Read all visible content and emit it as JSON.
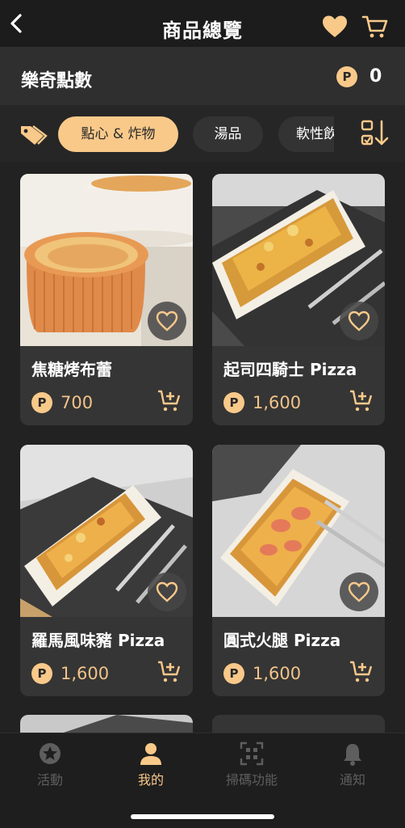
{
  "header": {
    "title": "商品總覽",
    "back_icon": "chevron-left-icon",
    "fav_icon": "heart-icon",
    "cart_icon": "cart-icon"
  },
  "points": {
    "label": "樂奇點數",
    "badge": "P",
    "value": "0"
  },
  "categories": {
    "tag_icon": "tag-icon",
    "chips": [
      {
        "label": "點心 & 炸物",
        "active": true
      },
      {
        "label": "湯品",
        "active": false
      },
      {
        "label": "軟性飲",
        "active": false
      }
    ],
    "sort_icon": "sort-icon"
  },
  "products": [
    {
      "name": "焦糖烤布蕾",
      "price": "700",
      "badge": "P"
    },
    {
      "name": "起司四騎士 Pizza",
      "price": "1,600",
      "badge": "P"
    },
    {
      "name": "羅馬風味豬 Pizza",
      "price": "1,600",
      "badge": "P"
    },
    {
      "name": "圓式火腿 Pizza",
      "price": "1,600",
      "badge": "P"
    }
  ],
  "tabbar": [
    {
      "label": "活動",
      "icon": "star-icon",
      "active": false
    },
    {
      "label": "我的",
      "icon": "user-icon",
      "active": true
    },
    {
      "label": "掃碼功能",
      "icon": "qr-icon",
      "active": false
    },
    {
      "label": "通知",
      "icon": "bell-icon",
      "active": false
    }
  ],
  "colors": {
    "accent": "#f9c98a",
    "background": "#222222",
    "card": "#353535"
  }
}
